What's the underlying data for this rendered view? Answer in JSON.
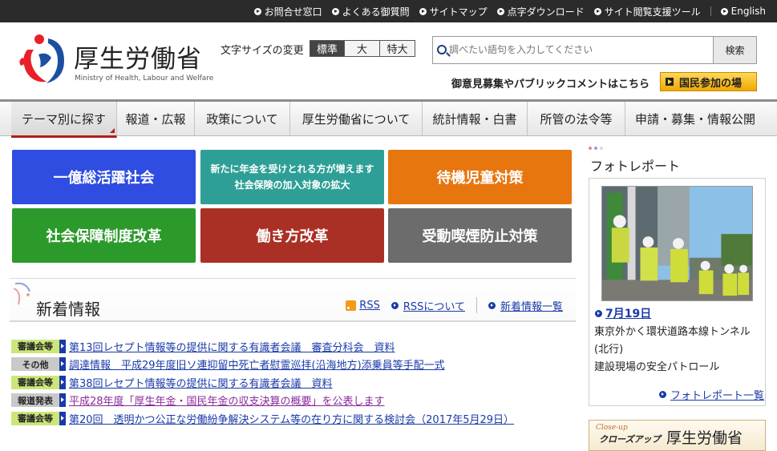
{
  "topbar": {
    "links": [
      "お問合せ窓口",
      "よくある御質問",
      "サイトマップ",
      "点字ダウンロード",
      "サイト閲覧支援ツール"
    ],
    "english": "English"
  },
  "header": {
    "title": "厚生労働省",
    "subtitle": "Ministry of Health, Labour and Welfare",
    "font_size_label": "文字サイズの変更",
    "font_sizes": [
      "標準",
      "大",
      "特大"
    ],
    "search_placeholder": "調べたい語句を入力してください",
    "search_button": "検索",
    "public_comment_text": "御意見募集やパブリックコメントはこちら",
    "public_button": "国民参加の場",
    "colors": {
      "logo_red": "#e8202a",
      "logo_blue": "#1d4fa0"
    }
  },
  "nav": {
    "items": [
      "テーマ別に探す",
      "報道・広報",
      "政策について",
      "厚生労働省について",
      "統計情報・白書",
      "所管の法令等",
      "申請・募集・情報公開"
    ]
  },
  "tiles": {
    "t1": "一億総活躍社会",
    "t2_line1": "新たに年金を受けとれる方が増えます",
    "t2_line2": "社会保険の加入対象の拡大",
    "t3": "待機児童対策",
    "t4": "社会保障制度改革",
    "t5": "働き方改革",
    "t6": "受動喫煙防止対策"
  },
  "news": {
    "title": "新着情報",
    "rss": "RSS",
    "about_rss": "RSSについて",
    "list_link": "新着情報一覧",
    "items": [
      {
        "tag": "審議会等",
        "text": "第13回レセプト情報等の提供に関する有識者会議　審査分科会　資料"
      },
      {
        "tag": "その他",
        "text": "調達情報　平成29年度旧ソ連抑留中死亡者慰霊巡拝(沿海地方)添乗員等手配一式"
      },
      {
        "tag": "審議会等",
        "text": "第38回レセプト情報等の提供に関する有識者会議　資料"
      },
      {
        "tag": "報道発表",
        "text": "平成28年度「厚生年金・国民年金の収支決算の概要」を公表します"
      },
      {
        "tag": "審議会等",
        "text": "第20回　透明かつ公正な労働紛争解決システム等の在り方に関する検討会（2017年5月29日）"
      }
    ]
  },
  "photo": {
    "title": "フォトレポート",
    "date": "7月19日",
    "desc_line1": "東京外かく環状道路本線トンネル",
    "desc_line2": "(北行)",
    "desc_line3": "建設現場の安全パトロール",
    "more": "フォトレポート一覧"
  },
  "closeup": {
    "en": "Close-up",
    "jp": "クローズアップ",
    "name": "厚生労働省"
  }
}
